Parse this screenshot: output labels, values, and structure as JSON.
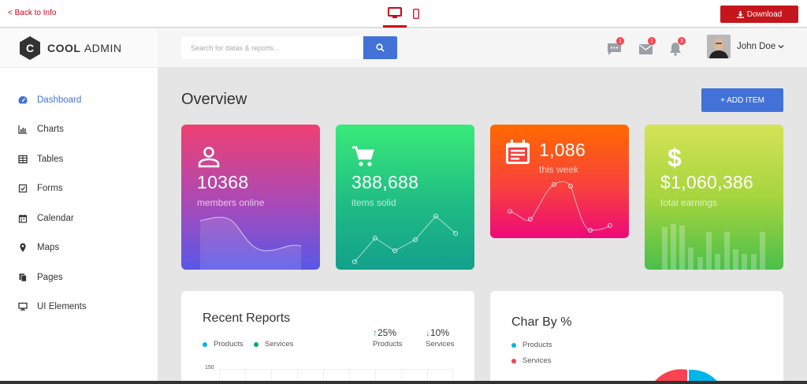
{
  "topbar": {
    "back_label": "< Back to Info",
    "download_label": "Download"
  },
  "logo": {
    "bold": "COOL",
    "light": "ADMIN"
  },
  "nav": {
    "items": [
      {
        "label": "Dashboard",
        "icon": "dashboard-icon",
        "active": true
      },
      {
        "label": "Charts",
        "icon": "bar-chart-icon"
      },
      {
        "label": "Tables",
        "icon": "table-icon"
      },
      {
        "label": "Forms",
        "icon": "check-square-icon"
      },
      {
        "label": "Calendar",
        "icon": "calendar-icon"
      },
      {
        "label": "Maps",
        "icon": "map-marker-icon"
      },
      {
        "label": "Pages",
        "icon": "copy-icon"
      },
      {
        "label": "UI Elements",
        "icon": "desktop-icon"
      }
    ]
  },
  "header": {
    "search_placeholder": "Search for datas & reports...",
    "notifications": {
      "messages": "1",
      "mail": "1",
      "alerts": "3"
    },
    "user_name": "John Doe"
  },
  "overview": {
    "title": "Overview",
    "add_item_label": "+ ADD ITEM"
  },
  "stats": [
    {
      "value": "10368",
      "label": "members online",
      "icon": "user-icon"
    },
    {
      "value": "388,688",
      "label": "items solid",
      "icon": "cart-icon"
    },
    {
      "value": "1,086",
      "label": "this week",
      "icon": "calendar-note-icon"
    },
    {
      "value": "$1,060,386",
      "label": "total earnings",
      "icon": "dollar-icon"
    }
  ],
  "recent_reports": {
    "title": "Recent Reports",
    "legend": [
      {
        "label": "Products",
        "color": "#00b5e9"
      },
      {
        "label": "Services",
        "color": "#00ad5f"
      }
    ],
    "products_pct": "25%",
    "products_label": "Products",
    "services_pct": "10%",
    "services_label": "Services",
    "y_top_tick": "150"
  },
  "char_by": {
    "title": "Char By %",
    "legend": [
      {
        "label": "Products",
        "color": "#00b5e9"
      },
      {
        "label": "Services",
        "color": "#fa4251"
      }
    ]
  },
  "colors": {
    "accent_blue": "#4272d7",
    "brand_red": "#c4161c",
    "badge_red": "#fa4251",
    "up_green": "#00ad5f",
    "down_red": "#fa4251"
  }
}
